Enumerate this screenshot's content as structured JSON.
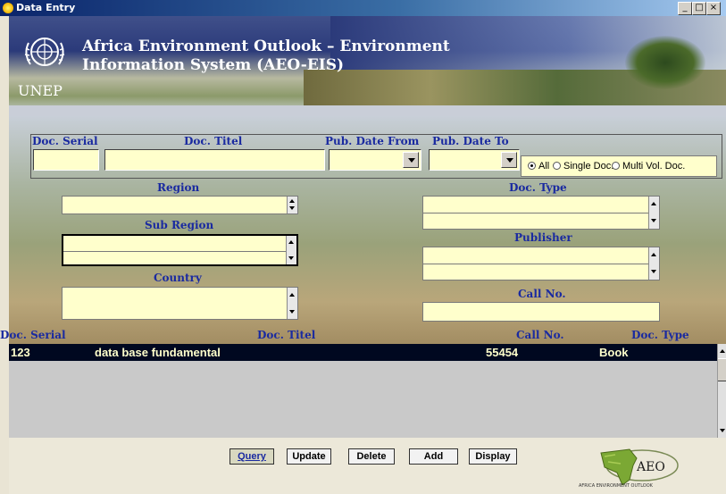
{
  "window": {
    "title": "Data Entry",
    "controls": [
      "_",
      "□",
      "×"
    ]
  },
  "banner": {
    "org": "UNEP",
    "title_line1": "Africa Environment Outlook – Environment",
    "title_line2": "Information System (AEO-EIS)"
  },
  "search": {
    "doc_serial_label": "Doc. Serial",
    "doc_serial_value": "",
    "doc_title_label": "Doc. Titel",
    "doc_title_value": "",
    "pub_date_from_label": "Pub. Date From",
    "pub_date_to_label": "Pub. Date To",
    "doc_scope_options": [
      {
        "label": "All",
        "selected": true
      },
      {
        "label": "Single Doc.",
        "selected": false
      },
      {
        "label": "Multi Vol. Doc.",
        "selected": false
      }
    ]
  },
  "filters": {
    "region_label": "Region",
    "sub_region_label": "Sub Region",
    "country_label": "Country",
    "doc_type_label": "Doc. Type",
    "publisher_label": "Publisher",
    "call_no_label": "Call No."
  },
  "grid": {
    "columns": [
      "Doc. Serial",
      "Doc. Titel",
      "Call No.",
      "Doc. Type"
    ],
    "rows": [
      {
        "serial": "123",
        "title": "data base fundamental",
        "call_no": "55454",
        "type": "Book"
      }
    ]
  },
  "actions": {
    "query": "Query",
    "update": "Update",
    "delete": "Delete",
    "add": "Add",
    "display": "Display"
  },
  "footer_logo": {
    "text": "AEO",
    "caption": "AFRICA ENVIRONMENT OUTLOOK"
  }
}
